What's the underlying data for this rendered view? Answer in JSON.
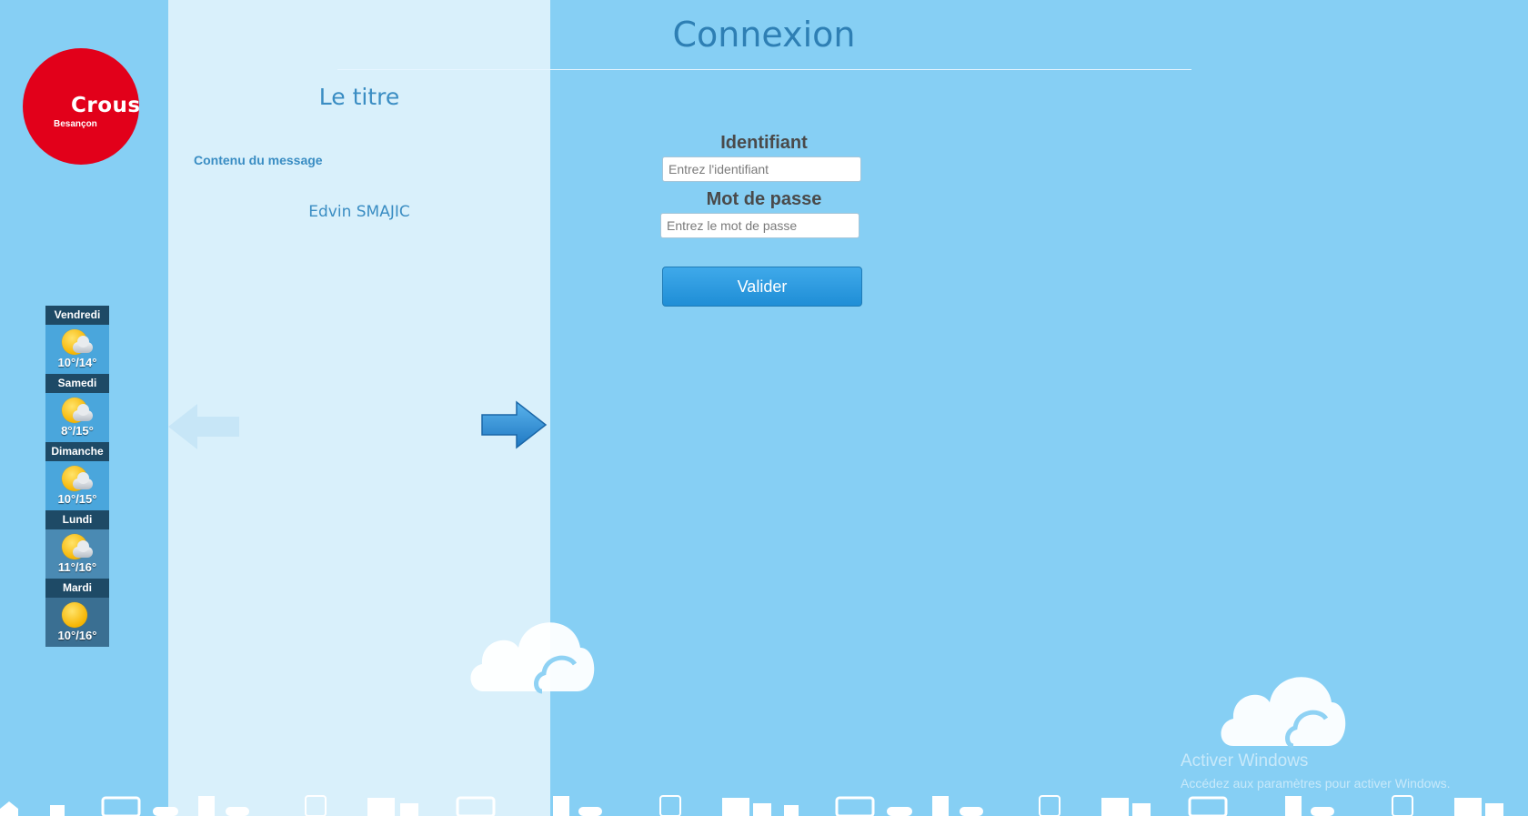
{
  "logo": {
    "word": "Crous",
    "city": "Besançon"
  },
  "weather": [
    {
      "day": "Vendredi",
      "temp": "10°/14°",
      "icon": "sun-cloud-icon",
      "color": "#4aa6dc"
    },
    {
      "day": "Samedi",
      "temp": "8°/15°",
      "icon": "sun-cloud-icon",
      "color": "#4aa6dc"
    },
    {
      "day": "Dimanche",
      "temp": "10°/15°",
      "icon": "sun-cloud-icon",
      "color": "#4aa6dc"
    },
    {
      "day": "Lundi",
      "temp": "11°/16°",
      "icon": "sun-cloud-icon",
      "color": "#4a8ab3"
    },
    {
      "day": "Mardi",
      "temp": "10°/16°",
      "icon": "sun-icon",
      "color": "#3a6f92"
    }
  ],
  "message": {
    "title": "Le titre",
    "content": "Contenu du message",
    "author": "Edvin SMAJIC"
  },
  "login": {
    "title": "Connexion",
    "username_label": "Identifiant",
    "username_placeholder": "Entrez l'identifiant",
    "password_label": "Mot de passe",
    "password_placeholder": "Entrez le mot de passe",
    "submit_label": "Valider"
  },
  "watermark": {
    "title": "Activer Windows",
    "subtitle": "Accédez aux paramètres pour activer Windows."
  },
  "colors": {
    "background": "#86cff4",
    "panel": "#d9f0fb",
    "accent": "#2e7fb4",
    "button": "#2a9be0",
    "logo": "#e2001a"
  }
}
